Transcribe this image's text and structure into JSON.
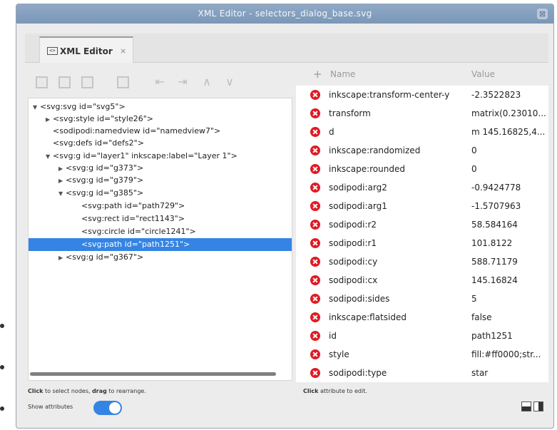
{
  "window": {
    "title": "XML Editor - selectors_dialog_base.svg",
    "close_glyph": "⊠"
  },
  "tab": {
    "label": "XML Editor",
    "close_glyph": "×",
    "icon_glyph": "<>"
  },
  "toolbar": {
    "icons": [
      "new-element-node-icon",
      "new-text-node-icon",
      "duplicate-node-icon",
      "delete-node-icon",
      "unindent-node-icon",
      "indent-node-icon",
      "raise-node-icon",
      "lower-node-icon"
    ]
  },
  "tree": {
    "nodes": [
      {
        "text": "<svg:svg id=\"svg5\">",
        "arrow": "▼"
      },
      {
        "text": "<svg:style id=\"style26\">",
        "arrow": "▶"
      },
      {
        "text": "<sodipodi:namedview id=\"namedview7\">",
        "arrow": ""
      },
      {
        "text": "<svg:defs id=\"defs2\">",
        "arrow": ""
      },
      {
        "text": "<svg:g id=\"layer1\" inkscape:label=\"Layer 1\">",
        "arrow": "▼"
      },
      {
        "text": "<svg:g id=\"g373\">",
        "arrow": "▶"
      },
      {
        "text": "<svg:g id=\"g379\">",
        "arrow": "▶"
      },
      {
        "text": "<svg:g id=\"g385\">",
        "arrow": "▼"
      },
      {
        "text": "<svg:path id=\"path729\">",
        "arrow": ""
      },
      {
        "text": "<svg:rect id=\"rect1143\">",
        "arrow": ""
      },
      {
        "text": "<svg:circle id=\"circle1241\">",
        "arrow": ""
      },
      {
        "text": "<svg:path id=\"path1251\">",
        "arrow": ""
      },
      {
        "text": "<svg:g id=\"g367\">",
        "arrow": "▶"
      }
    ]
  },
  "left_hint": {
    "click": "Click",
    "click_text": " to select nodes, ",
    "drag": "drag",
    "drag_text": " to rearrange."
  },
  "show_attributes": {
    "label": "Show attributes",
    "on": true
  },
  "attributes": {
    "header_plus": "+",
    "header_name": "Name",
    "header_value": "Value",
    "rows": [
      {
        "name": "inkscape:transform-center-y",
        "value": "-2.3522823"
      },
      {
        "name": "transform",
        "value": "matrix(0.23010..."
      },
      {
        "name": "d",
        "value": "m 145.16825,4..."
      },
      {
        "name": "inkscape:randomized",
        "value": "0"
      },
      {
        "name": "inkscape:rounded",
        "value": "0"
      },
      {
        "name": "sodipodi:arg2",
        "value": "-0.9424778"
      },
      {
        "name": "sodipodi:arg1",
        "value": "-1.5707963"
      },
      {
        "name": "sodipodi:r2",
        "value": "58.584164"
      },
      {
        "name": "sodipodi:r1",
        "value": "101.8122"
      },
      {
        "name": "sodipodi:cy",
        "value": "588.71179"
      },
      {
        "name": "sodipodi:cx",
        "value": "145.16824"
      },
      {
        "name": "sodipodi:sides",
        "value": "5"
      },
      {
        "name": "inkscape:flatsided",
        "value": "false"
      },
      {
        "name": "id",
        "value": "path1251"
      },
      {
        "name": "style",
        "value": "fill:#ff0000;str..."
      },
      {
        "name": "sodipodi:type",
        "value": "star"
      }
    ]
  },
  "right_hint": {
    "click": "Click",
    "text": " attribute to edit."
  },
  "colors": {
    "accent": "#3584e4",
    "delete": "#e01b24",
    "titlebar": "#7b97b7"
  }
}
